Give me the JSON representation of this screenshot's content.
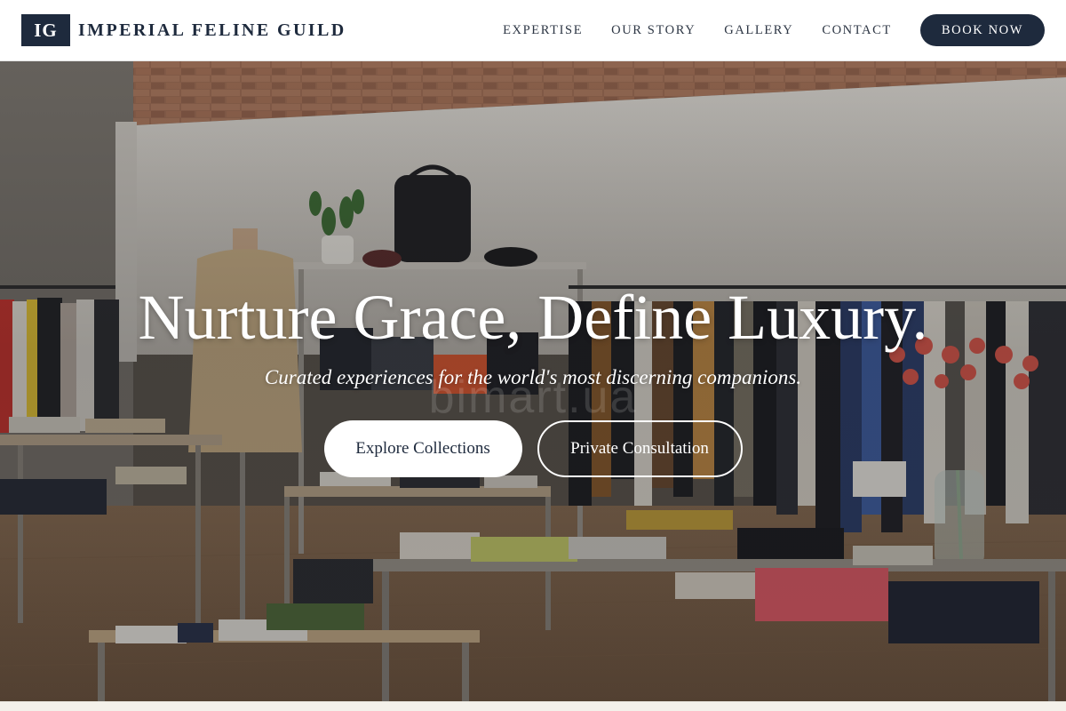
{
  "brand": {
    "mark": "IG",
    "name": "IMPERIAL FELINE GUILD"
  },
  "nav": {
    "links": [
      {
        "label": "EXPERTISE"
      },
      {
        "label": "OUR STORY"
      },
      {
        "label": "GALLERY"
      },
      {
        "label": "CONTACT"
      }
    ],
    "cta_label": "BOOK NOW"
  },
  "hero": {
    "title": "Nurture Grace, Define Luxury.",
    "subtitle": "Curated experiences for the world's most discerning companions.",
    "primary_button": "Explore Collections",
    "secondary_button": "Private Consultation",
    "background_image": "boutique-interior-photo",
    "watermark": "bimart.ua"
  },
  "colors": {
    "navy": "#1e2a3d",
    "white": "#ffffff",
    "page_bg": "#f4f1ea"
  }
}
